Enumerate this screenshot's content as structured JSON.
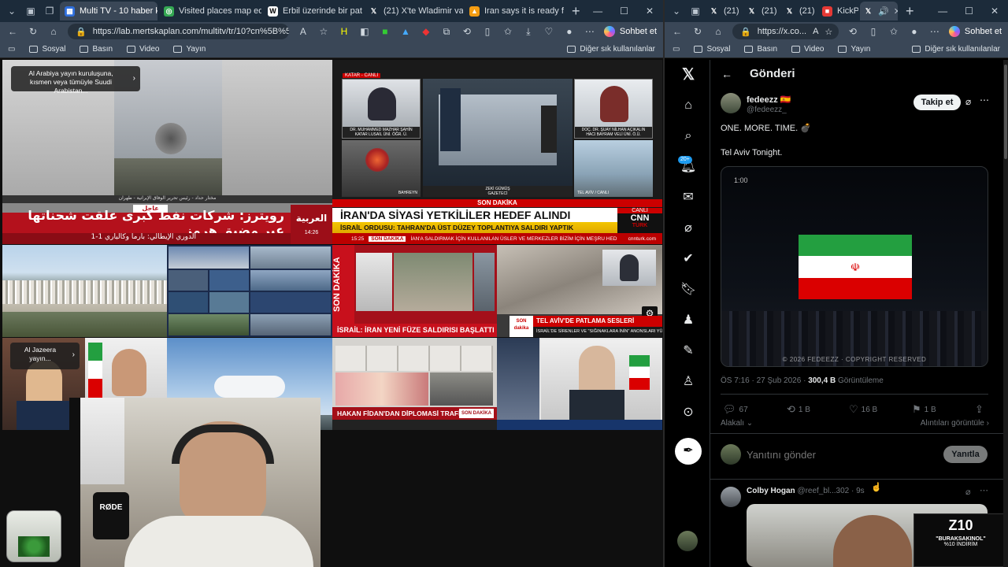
{
  "left_window": {
    "tabs": [
      {
        "label": "Multi TV - 10 haber k",
        "active": true,
        "favicon": "M",
        "color": "#2f6fdc"
      },
      {
        "label": "Visited places map editor",
        "active": false,
        "favicon": "◎",
        "color": "#34a853"
      },
      {
        "label": "Erbil üzerinde bir patlama",
        "active": false,
        "favicon": "W",
        "color": "#ffffff"
      },
      {
        "label": "(21) X'te Wladimir van W",
        "active": false,
        "favicon": "𝕏",
        "color": "#000000"
      },
      {
        "label": "Iran says it is ready for wa",
        "active": false,
        "favicon": "▲",
        "color": "#f39c12"
      }
    ],
    "url": "https://lab.mertskaplan.com/multitv/tr/10?cn%5B%5D=Al-...",
    "copilot": "Sohbet et",
    "bookmarks": [
      "Sosyal",
      "Basın",
      "Video",
      "Yayın"
    ],
    "bookmarks_other": "Diğer sık kullanılanlar",
    "pip_top": "Al Arabiya yayın kuruluşuna, kısmen veya tümüyle Suudi Arabistan...",
    "pip_bottom": "Al Jazeera yayın...",
    "arabiya": {
      "caption": "مختار حداد - رئيس تحرير الوفاق الإيرانية - طهران",
      "urgent": "عاجل",
      "headline": "رويترز: شركات نفط كبرى علقت شحناتها عبر مضيق هرمز",
      "sub": "الدوري الإيطالي: بارما وكالياري 1-1",
      "logo": "العربية",
      "time": "14:26"
    },
    "cnn": {
      "tag": "KATAR - CANLI",
      "guest1": "DR. MUHAMMED MAZHAR ŞAHİN",
      "guest1_sub": "KATAR LUSAİL ÜNİ. ÖĞR. Ü.",
      "guest2": "DOÇ. DR. ŞUAY NİLHAN AÇIKALIN",
      "guest2_sub": "HACI BAYRAM VELİ ÜNİ. Ö.Ü.",
      "anchor": "ZEKİ GÜMÜŞ",
      "anchor_sub": "GAZETECİ",
      "loc1": "BAHREYN",
      "loc2": "TEL AVİV / CANLI",
      "breaking": "SON DAKİKA",
      "headline1": "İRAN'DA SİYASİ YETKİLİLER HEDEF ALINDI",
      "live": "CANLI",
      "headline2": "İSRAİL ORDUSU: TAHRAN'DA ÜST DÜZEY TOPLANTIYA SALDIRI YAPTIK",
      "ticker_time": "15:25",
      "ticker_tag": "SON DAKİKA",
      "ticker": "İAN'A SALDIRMAK İÇİN KULLANILAN ÜSLER VE MERKEZLER BİZİM İÇİN MEŞRU HED",
      "logo1": "CNN",
      "logo2": "TÜRK",
      "site": "cnnturk.com"
    },
    "haber": {
      "vertical": "SON DAKİKA",
      "headline": "İSRAİL: İRAN YENİ FÜZE SALDIRISI BAŞLATTI",
      "sub2": "HAKAN FİDAN'DAN DİPLOMASİ TRAFİĞİ",
      "tag2": "SON DAKİKA"
    },
    "trt": {
      "tag": "SON dakika",
      "headline": "TEL AVİV'DE PATLAMA SESLERİ",
      "sub": "İSRAİL'DE SİRENLER VE \"SIĞINAKLARA İNİN\" ANONSLARI YÜKSELİYOR"
    },
    "webcam": {
      "brand": "RØDE"
    }
  },
  "right_window": {
    "tabs": [
      "(21) X",
      "(21) X",
      "(21) İsr",
      "KickPe",
      "X"
    ],
    "url": "https://x.co...",
    "copilot": "Sohbet et",
    "bookmarks": [
      "Sosyal",
      "Basın",
      "Video",
      "Yayın"
    ],
    "bookmarks_other": "Diğer sık kullanılanlar",
    "page_title": "Gönderi",
    "notif_badge": "20+",
    "post": {
      "display_name": "fedeezz",
      "flag": "🇪🇸",
      "handle": "@fedeezz_",
      "follow": "Takip et",
      "line1": "ONE. MORE. TIME. 💣",
      "line2": "Tel Aviv Tonight.",
      "video_time": "1:00",
      "watermark": "© 2026 FEDEEZZ · COPYRIGHT RESERVED",
      "time": "ÖS 7:16 · 27 Şub 2026 ·",
      "views": "300,4 B",
      "views_label": "Görüntüleme",
      "replies": "67",
      "reposts": "1 B",
      "likes": "16 B",
      "bookmarks": "1 B",
      "related": "Alakalı",
      "quotes": "Alıntıları görüntüle"
    },
    "reply": {
      "placeholder": "Yanıtını gönder",
      "button": "Yanıtla"
    },
    "next_post": {
      "name": "Colby Hogan",
      "handle": "@reef_bl...302 · 9s"
    },
    "promo": {
      "logo": "Z10",
      "line1": "\"BURAKSAKINOL\"",
      "line2": "%10 İNDİRİM"
    }
  },
  "colors": {
    "tab_bar": "#1c2b3a",
    "toolbar": "#3a4757",
    "x_bg": "#000000",
    "iran_green": "#239f40",
    "iran_red": "#da0000",
    "cnn_yellow": "#f3c600",
    "arabiya_red": "#b4111c"
  }
}
